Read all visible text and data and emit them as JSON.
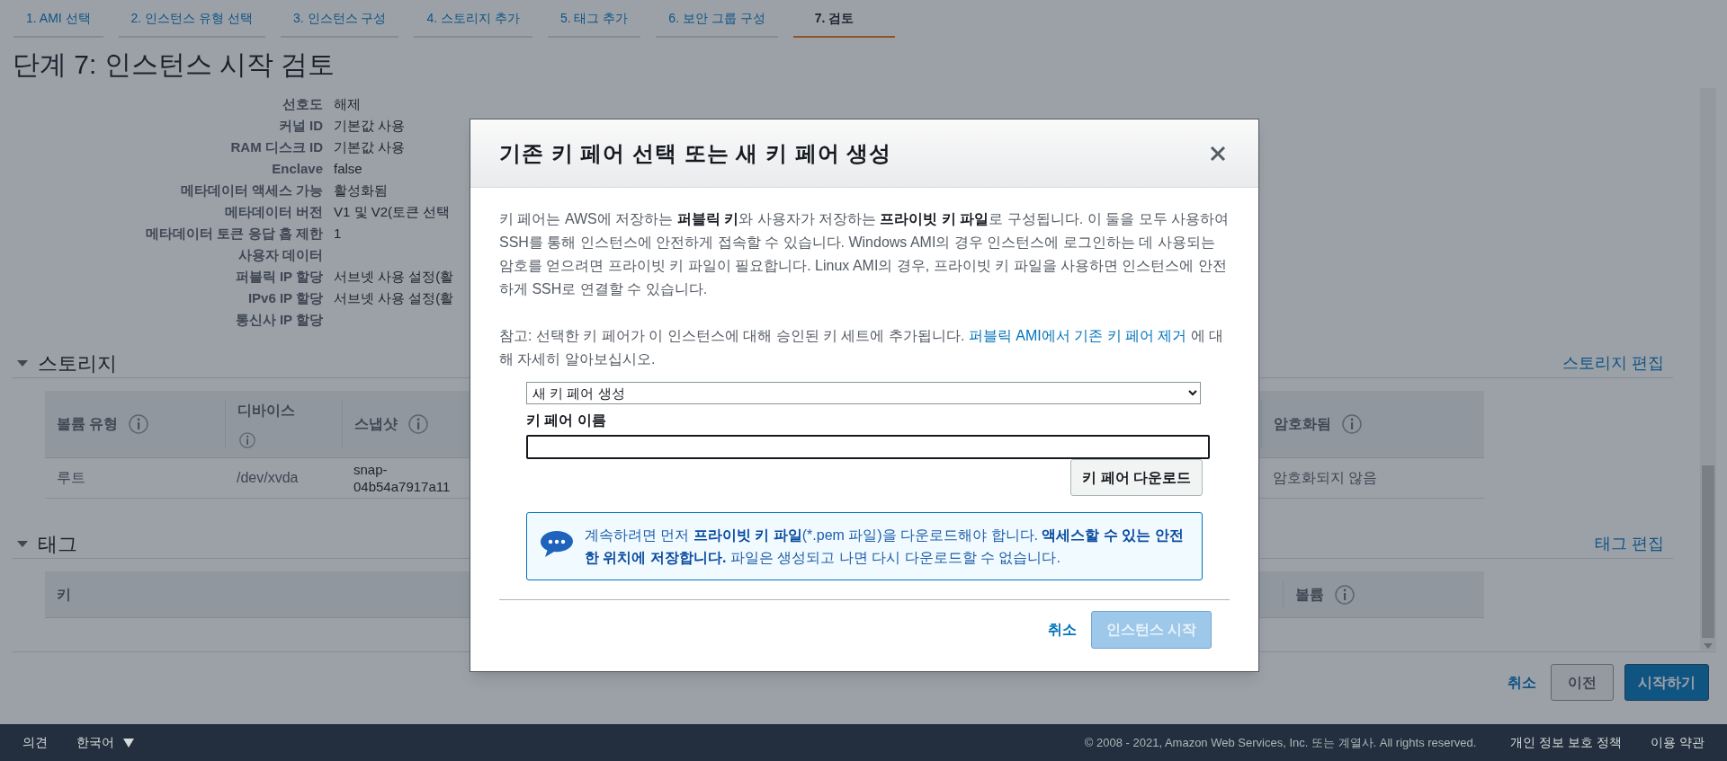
{
  "tabs": [
    {
      "label": "1. AMI 선택",
      "selected": false
    },
    {
      "label": "2. 인스턴스 유형 선택",
      "selected": false
    },
    {
      "label": "3. 인스턴스 구성",
      "selected": false
    },
    {
      "label": "4. 스토리지 추가",
      "selected": false
    },
    {
      "label": "5. 태그 추가",
      "selected": false
    },
    {
      "label": "6. 보안 그룹 구성",
      "selected": false
    },
    {
      "label": "7. 검토",
      "selected": true
    }
  ],
  "page_title": "단계 7: 인스턴스 시작 검토",
  "details": [
    {
      "label": "선호도",
      "value": "해제"
    },
    {
      "label": "커널 ID",
      "value": "기본값 사용"
    },
    {
      "label": "RAM 디스크 ID",
      "value": "기본값 사용"
    },
    {
      "label": "Enclave",
      "value": "false"
    },
    {
      "label": "메타데이터 액세스 가능",
      "value": "활성화됨"
    },
    {
      "label": "메타데이터 버전",
      "value": "V1 및 V2(토큰 선택"
    },
    {
      "label": "메타데이터 토큰 응답 홉 제한",
      "value": "1"
    },
    {
      "label": "사용자 데이터"
    },
    {
      "label": "퍼블릭 IP 할당",
      "value": "서브넷 사용 설정(활"
    },
    {
      "label": "IPv6 IP 할당",
      "value": "서브넷 사용 설정(활"
    },
    {
      "label": "통신사 IP 할당"
    }
  ],
  "storage": {
    "title": "스토리지",
    "expanded": true,
    "edit_link": "스토리지 편집",
    "columns": [
      {
        "label": "볼륨 유형",
        "info": true
      },
      {
        "label": "디바이스",
        "info": true
      },
      {
        "label": "스냅샷",
        "info": true
      },
      {
        "label": "암호화됨",
        "info": true
      }
    ],
    "rows": [
      [
        "루트",
        "/dev/xvda",
        "snap-04b54a7917a11",
        "암호화되지 않음"
      ]
    ]
  },
  "tags": {
    "title": "태그",
    "expanded": true,
    "edit_link": "태그 편집",
    "columns": [
      {
        "label": "키",
        "info": false
      },
      {
        "label": "볼륨",
        "info": true
      }
    ]
  },
  "actions": {
    "cancel": "취소",
    "previous": "이전",
    "launch": "시작하기"
  },
  "modal": {
    "title": "기존 키 페어 선택 또는 새 키 페어 생성",
    "description": "키 페어는 AWS에 저장하는 **퍼블릭 키**와 사용자가 저장하는 **프라이빗 키 파일**로 구성됩니다. 이 둘을 모두 사용하여 SSH를 통해 인스턴스에 안전하게 접속할 수 있습니다. Windows AMI의 경우 인스턴스에 로그인하는 데 사용되는 암호를 얻으려면 프라이빗 키 파일이 필요합니다. Linux AMI의 경우, 프라이빗 키 파일을 사용하면 인스턴스에 안전하게 SSH로 연결할 수 있습니다.",
    "note": "참고: 선택한 키 페어가 이 인스턴스에 대해 승인된 키 세트에 추가됩니다. ",
    "note_link": "퍼블릭 AMI에서 기존 키 페어 제거",
    "note_suffix": " 에 대해 자세히 알아보십시오.",
    "select_value": "새 키 페어 생성",
    "key_name_label": "키 페어 이름",
    "download_button": "키 페어 다운로드",
    "info_message": "계속하려면 먼저 **프라이빗 키 파일**(*.pem 파일)을 다운로드해야 합니다. **액세스할 수 있는 안전한 위치에 저장합니다.** 파일은 생성되고 나면 다시 다운로드할 수 없습니다.",
    "cancel": "취소",
    "launch_button": {
      "label": "인스턴스 시작",
      "disabled": true
    }
  },
  "footer": {
    "feedback": "의견",
    "language": "한국어",
    "copyright": "© 2008 - 2021, Amazon Web Services, Inc. 또는 계열사. All rights reserved.",
    "links": [
      "개인 정보 보호 정책",
      "이용 약관"
    ]
  }
}
